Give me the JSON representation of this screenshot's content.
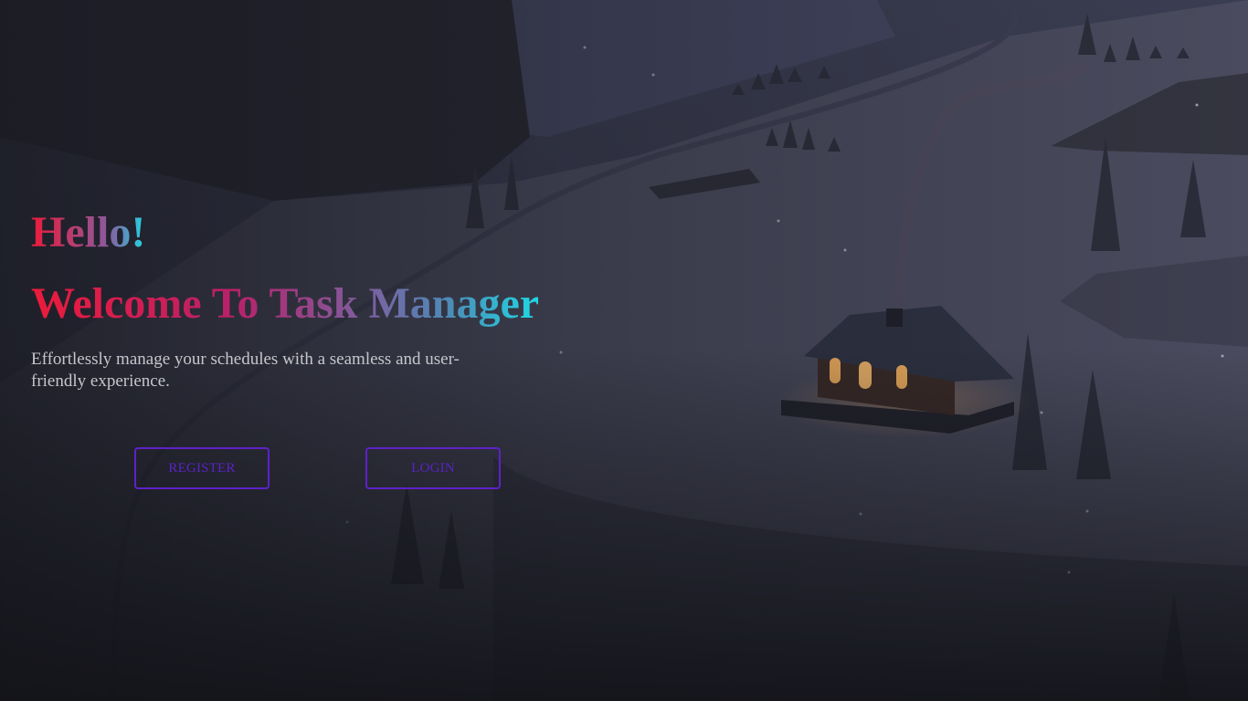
{
  "hero": {
    "greeting": "Hello!",
    "title": "Welcome To Task Manager",
    "tagline": "Effortlessly manage your schedules with a seamless and user-friendly experience."
  },
  "actions": {
    "register_label": "REGISTER",
    "login_label": "LOGIN"
  },
  "colors": {
    "gradient_start": "#ec1b3a",
    "gradient_end": "#1fd8e5",
    "button_accent": "#5e21c8",
    "tagline": "#c6c6cc"
  },
  "background": {
    "scene": "night-snowy-valley-cabin-illustration"
  }
}
